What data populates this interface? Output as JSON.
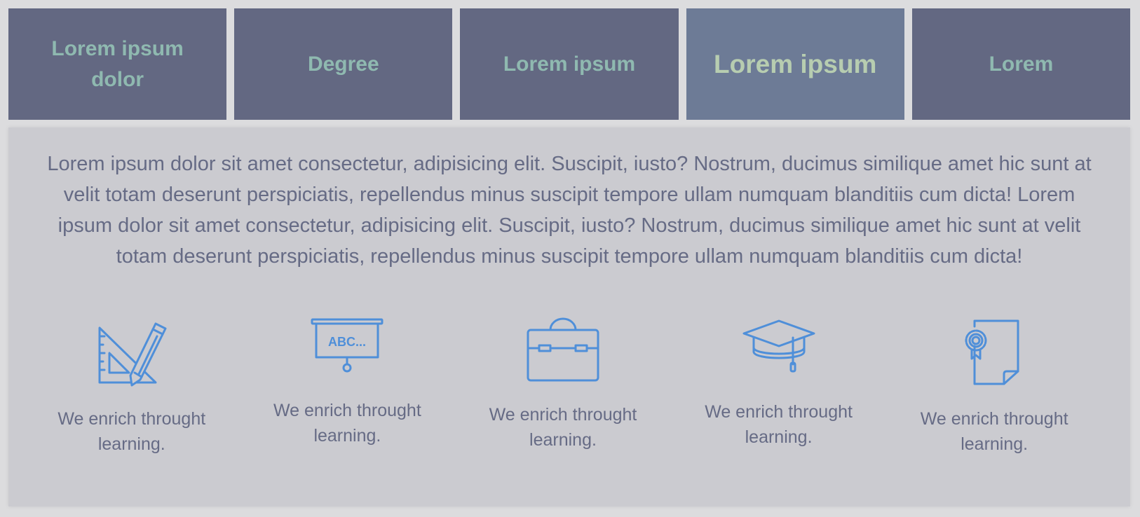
{
  "tabs": [
    {
      "label": "Lorem ipsum dolor",
      "active": false
    },
    {
      "label": "Degree",
      "active": false
    },
    {
      "label": "Lorem ipsum",
      "active": false
    },
    {
      "label": "Lorem ipsum",
      "active": true
    },
    {
      "label": "Lorem",
      "active": false
    }
  ],
  "panel": {
    "intro": "Lorem ipsum dolor sit amet consectetur, adipisicing elit. Suscipit, iusto? Nostrum, ducimus similique amet hic sunt at velit totam deserunt perspiciatis, repellendus minus suscipit tempore ullam numquam blanditiis cum dicta! Lorem ipsum dolor sit amet consectetur, adipisicing elit. Suscipit, iusto? Nostrum, ducimus similique amet hic sunt at velit totam deserunt perspiciatis, repellendus minus suscipit tempore ullam numquam blanditiis cum dicta!",
    "features": [
      {
        "icon": "ruler-pencil-icon",
        "caption": "We enrich throught learning."
      },
      {
        "icon": "presentation-board-icon",
        "board_text": "ABC...",
        "caption": "We enrich throught learning."
      },
      {
        "icon": "briefcase-icon",
        "caption": "We enrich throught learning."
      },
      {
        "icon": "graduation-cap-icon",
        "caption": "We enrich throught learning."
      },
      {
        "icon": "certificate-icon",
        "caption": "We enrich throught learning."
      }
    ]
  },
  "colors": {
    "page_bg": "#dcdcde",
    "tab_bg": "#636882",
    "tab_active_bg": "#6d7b96",
    "tab_text": "#8fb9b0",
    "tab_active_text": "#b7cdb0",
    "panel_bg": "#cbcbd0",
    "body_text": "#666b85",
    "icon_stroke": "#4f8fd9"
  }
}
